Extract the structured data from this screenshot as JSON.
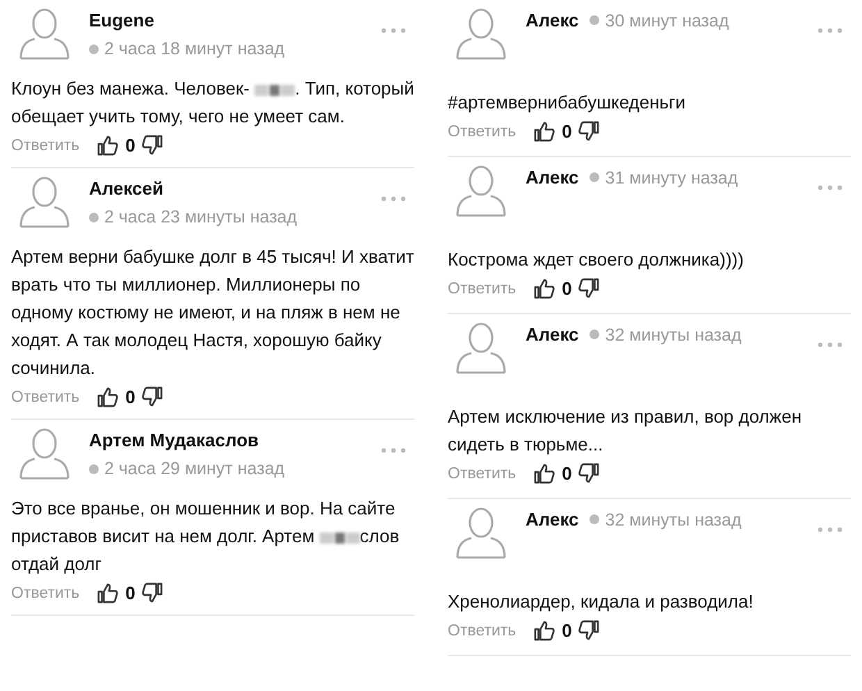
{
  "columns": [
    {
      "kind": "stacked",
      "comments": [
        {
          "author": "Eugene",
          "time": "2 часа 18 минут назад",
          "body": [
            {
              "kind": "text",
              "text": "Клоун без манежа. Человек- "
            },
            {
              "kind": "redacted"
            },
            {
              "kind": "text",
              "text": ". Тип, который обещает учить тому, чего не умеет сам."
            }
          ],
          "reply": "Ответить",
          "likes": "0"
        },
        {
          "author": "Алексей",
          "time": "2 часа 23 минуты назад",
          "body": [
            {
              "kind": "text",
              "text": "Артем верни бабушке долг в 45 тысяч! И хватит врать что ты миллионер. Миллионеры по одному костюму не имеют, и на пляж в нем не ходят. А так молодец Настя, хорошую байку сочинила."
            }
          ],
          "reply": "Ответить",
          "likes": "0"
        },
        {
          "author": "Артем Мудакаслов",
          "time": "2 часа 29 минут назад",
          "body": [
            {
              "kind": "text",
              "text": "Это все вранье, он мошенник и вор. На сайте приставов висит на нем долг. Артем "
            },
            {
              "kind": "redacted"
            },
            {
              "kind": "text",
              "text": "слов отдай долг"
            }
          ],
          "reply": "Ответить",
          "likes": "0"
        }
      ]
    },
    {
      "kind": "inline",
      "comments": [
        {
          "author": "Алекс",
          "time": "30 минут назад",
          "body": [
            {
              "kind": "text",
              "text": "#артемвернибабушкеденьги"
            }
          ],
          "reply": "Ответить",
          "likes": "0"
        },
        {
          "author": "Алекс",
          "time": "31 минуту назад",
          "body": [
            {
              "kind": "text",
              "text": "Кострома ждет своего должника))))"
            }
          ],
          "reply": "Ответить",
          "likes": "0"
        },
        {
          "author": "Алекс",
          "time": "32 минуты назад",
          "body": [
            {
              "kind": "text",
              "text": "Артем исключение из правил, вор должен сидеть в тюрьме..."
            }
          ],
          "reply": "Ответить",
          "likes": "0"
        },
        {
          "author": "Алекс",
          "time": "32 минуты назад",
          "body": [
            {
              "kind": "text",
              "text": "Хренолиардер, кидала и разводила!"
            }
          ],
          "reply": "Ответить",
          "likes": "0"
        }
      ]
    }
  ]
}
